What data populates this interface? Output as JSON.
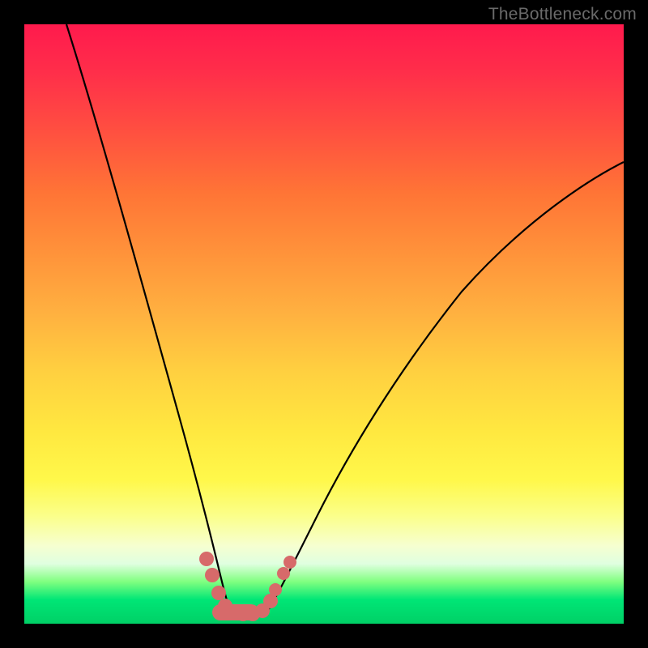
{
  "watermark": "TheBottleneck.com",
  "chart_data": {
    "type": "line",
    "title": "",
    "xlabel": "",
    "ylabel": "",
    "xlim": [
      0,
      100
    ],
    "ylim": [
      0,
      100
    ],
    "series": [
      {
        "name": "left-curve",
        "x": [
          7,
          10,
          13,
          16,
          19,
          22,
          25,
          27,
          29,
          30,
          31,
          32,
          33
        ],
        "y": [
          100,
          86,
          72,
          59,
          46,
          34,
          23,
          16,
          10,
          7,
          5,
          3,
          2
        ]
      },
      {
        "name": "right-curve",
        "x": [
          40,
          42,
          45,
          48,
          52,
          57,
          63,
          70,
          78,
          88,
          100
        ],
        "y": [
          2,
          4,
          8,
          13,
          19,
          26,
          34,
          43,
          52,
          62,
          72
        ]
      },
      {
        "name": "bottom-marker-band",
        "x": [
          29,
          30,
          31,
          32,
          33,
          34,
          35,
          36,
          37,
          38,
          39,
          40,
          41,
          42,
          43
        ],
        "y": [
          10,
          7,
          5,
          3,
          2,
          1.5,
          1.3,
          1.3,
          1.3,
          1.5,
          2,
          3,
          5,
          7,
          9
        ]
      }
    ],
    "background_gradient": {
      "stops": [
        {
          "pos": 0,
          "color": "#ff1a4d"
        },
        {
          "pos": 18,
          "color": "#ff5040"
        },
        {
          "pos": 38,
          "color": "#ff923a"
        },
        {
          "pos": 58,
          "color": "#ffd040"
        },
        {
          "pos": 76,
          "color": "#fff84a"
        },
        {
          "pos": 90,
          "color": "#e0ffe0"
        },
        {
          "pos": 100,
          "color": "#00d066"
        }
      ]
    },
    "marker_color": "#d76a6a",
    "curve_color": "#000000"
  }
}
